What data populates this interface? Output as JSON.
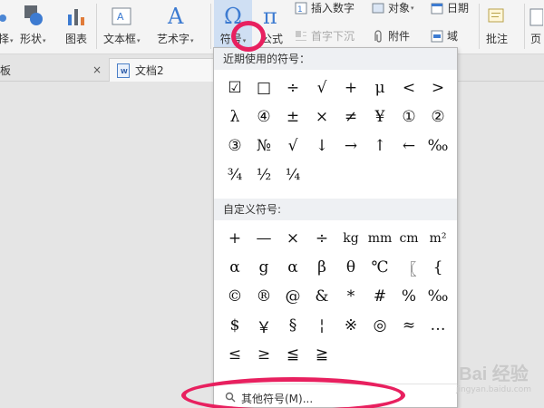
{
  "ribbon": {
    "cut_left_label": "择",
    "shape_label": "形状",
    "chart_label": "图表",
    "textbox_label": "文本框",
    "arttext_label": "艺术字",
    "symbol_label": "符号",
    "formula_label": "公式",
    "insert_number_label": "插入数字",
    "object_label": "对象",
    "date_label": "日期",
    "dropcap_label": "首字下沉",
    "attachment_label": "附件",
    "field_label": "域",
    "comment_label": "批注",
    "page_cut_label": "页"
  },
  "tabs": {
    "tab1_label": "模板",
    "tab1_close": "×",
    "tab2_label": "文档2"
  },
  "symbol_panel": {
    "recent_header": "近期使用的符号：",
    "recent_symbols": [
      "☑",
      "□",
      "÷",
      "√",
      "+",
      "μ",
      "<",
      ">",
      "λ",
      "④",
      "±",
      "×",
      "≠",
      "¥",
      "①",
      "②",
      "③",
      "№",
      "√",
      "↓",
      "→",
      "↑",
      "←",
      "‰",
      "¾",
      "½",
      "¼"
    ],
    "custom_header": "自定义符号:",
    "custom_symbols": [
      "+",
      "—",
      "×",
      "÷",
      "kg",
      "mm",
      "cm",
      "m²",
      "α",
      "g",
      "α",
      "β",
      "θ",
      "℃",
      "〖",
      "{",
      "©",
      "®",
      "@",
      "&",
      "*",
      "#",
      "%",
      "‰",
      "$",
      "￥",
      "§",
      "¦",
      "※",
      "◎",
      "≈",
      "…",
      "≤",
      "≥",
      "≦",
      "≧"
    ],
    "more_label": "其他符号(M)..."
  },
  "watermark": {
    "main": "Bai 经验",
    "sub": "jingyan.baidu.com"
  },
  "colors": {
    "accent_mark": "#e8205f",
    "symbol_icon": "#3d7bd1"
  }
}
